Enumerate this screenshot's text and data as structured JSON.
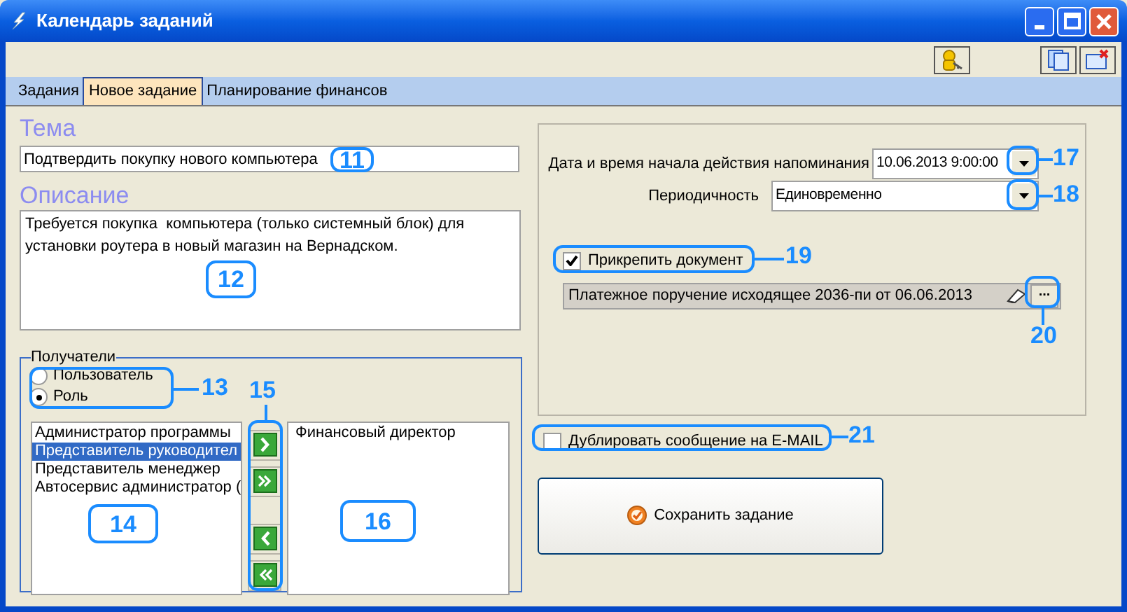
{
  "window": {
    "title": "Календарь заданий"
  },
  "tabs": [
    {
      "label": "Задания",
      "selected": false
    },
    {
      "label": "Новое задание",
      "selected": true
    },
    {
      "label": "Планирование финансов",
      "selected": false
    }
  ],
  "subject": {
    "label": "Тема",
    "value": "Подтвердить покупку нового компьютера"
  },
  "description": {
    "label": "Описание",
    "value": "Требуется покупка  компьютера (только системный блок) для установки роутера в новый магазин на Вернадском."
  },
  "recipients": {
    "title": "Получатели",
    "modes": [
      {
        "label": "Пользователь",
        "selected": false
      },
      {
        "label": "Роль",
        "selected": true
      }
    ],
    "available": [
      {
        "label": "Администратор программы",
        "selected": false
      },
      {
        "label": "Представитель руководител",
        "selected": true
      },
      {
        "label": "Представитель менеджер",
        "selected": false
      },
      {
        "label": "Автосервис администратор (",
        "selected": false
      }
    ],
    "transfer_buttons": [
      {
        "kind": "add"
      },
      {
        "kind": "add_all"
      },
      {
        "kind": "remove"
      },
      {
        "kind": "remove_all"
      }
    ],
    "chosen": [
      {
        "label": "Финансовый директор",
        "selected": false
      }
    ]
  },
  "reminder": {
    "start_label": "Дата и время начала действия напоминания",
    "start_value": "10.06.2013 9:00:00",
    "period_label": "Периодичность",
    "period_value": "Единовременно"
  },
  "attachment": {
    "label": "Прикрепить документ",
    "checked": true,
    "document": "Платежное поручение исходящее 2036-пи от 06.06.2013",
    "browse_button": "..."
  },
  "email": {
    "label": "Дублировать сообщение на E-MAIL",
    "checked": false
  },
  "save_button": "Сохранить задание",
  "callouts": [
    {
      "label": "11"
    },
    {
      "label": "12"
    },
    {
      "label": "13"
    },
    {
      "label": "14"
    },
    {
      "label": "15"
    },
    {
      "label": "16"
    },
    {
      "label": "17"
    },
    {
      "label": "18"
    },
    {
      "label": "19"
    },
    {
      "label": "20"
    },
    {
      "label": "21"
    }
  ]
}
